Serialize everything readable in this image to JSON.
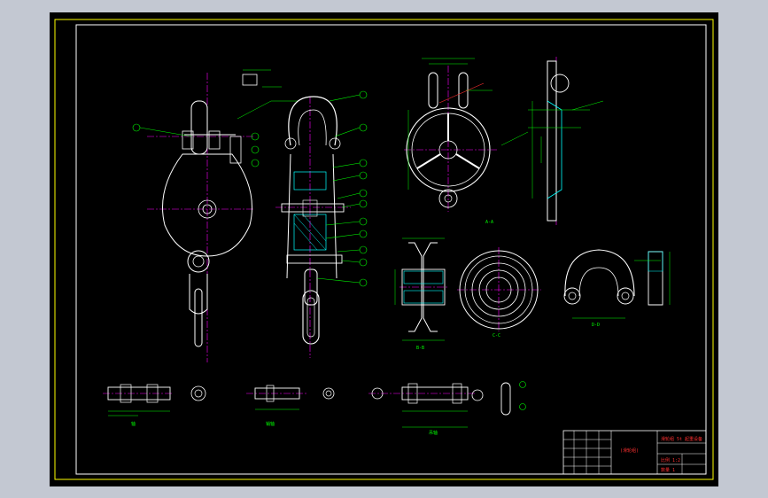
{
  "drawing": {
    "title_block": {
      "part_name": "(滑轮组)",
      "spec_line": "滑轮组 5t 起重设备",
      "row_1": "比例  1:2",
      "row_2": "数量  1"
    },
    "view_labels": {
      "side_view": "A-A",
      "pulley_section": "B-B",
      "pulley_face": "C-C",
      "hook_detail": "D-D",
      "shaft_1": "轴",
      "shaft_2": "销轴",
      "shaft_3": "吊轴"
    },
    "balloons": [
      "1",
      "2",
      "3",
      "4",
      "5",
      "6",
      "7",
      "8",
      "9",
      "10",
      "11",
      "12",
      "13"
    ],
    "colors": {
      "background": "#000000",
      "frame": "#ffff00",
      "outline": "#ffffff",
      "dimension": "#00ff00",
      "centerline": "#ff00ff",
      "hatch": "#00ffff",
      "hidden": "#4060ff",
      "title_text": "#ff3030"
    }
  }
}
